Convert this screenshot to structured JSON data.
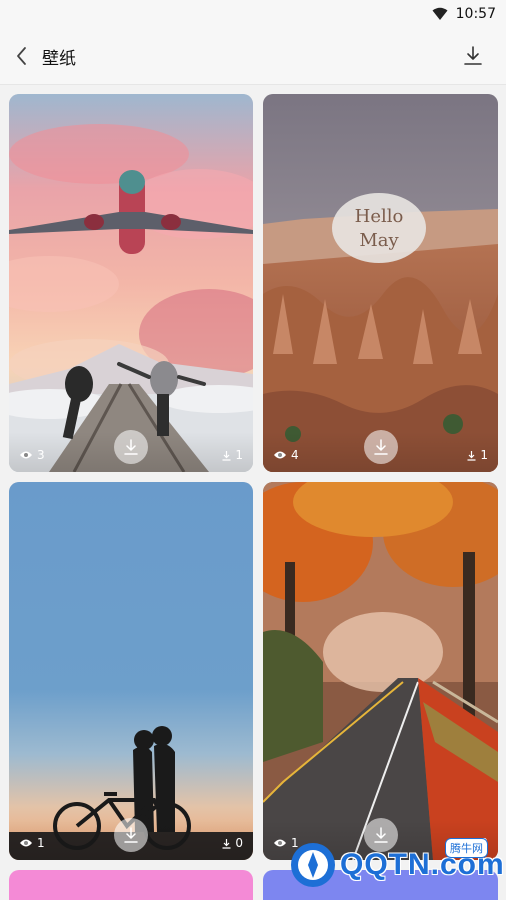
{
  "status_bar": {
    "time": "10:57"
  },
  "app_bar": {
    "title": "壁纸"
  },
  "wallpapers": [
    {
      "views": "3",
      "downloads": "1"
    },
    {
      "views": "4",
      "downloads": "1",
      "overlay_text_line1": "Hello",
      "overlay_text_line2": "May"
    },
    {
      "views": "1",
      "downloads": "0"
    },
    {
      "views": "1",
      "downloads": "0"
    }
  ],
  "watermark": {
    "logo_text": "QQTN.com",
    "tag": "腾牛网"
  },
  "colors": {
    "background": "#f2f2f2",
    "icon": "#333333",
    "watermark_blue": "#1d6fd6"
  }
}
